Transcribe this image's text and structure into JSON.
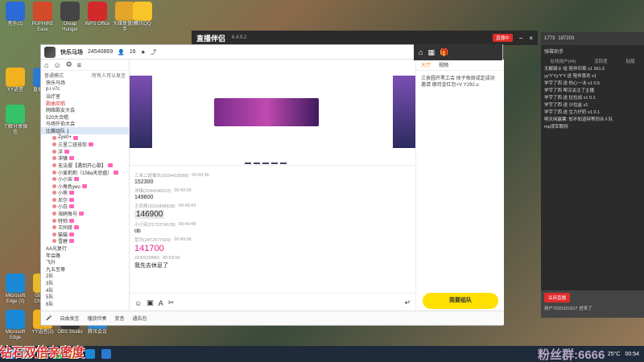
{
  "desktop_icons": [
    {
      "label": "音乐(1)",
      "color": "#2c6bd6"
    },
    {
      "label": "PUPHIRE Ease",
      "color": "#d24a2a"
    },
    {
      "label": "Dreap Hunger",
      "color": "#444444"
    },
    {
      "label": "WPS Office",
      "color": "#d22a2a"
    },
    {
      "label": "大雄复盘助手",
      "color": "#e4a62a"
    },
    {
      "label": "腾讯QQ",
      "color": "#f7c52a"
    },
    {
      "label": "YY语音",
      "color": "#f2b21e"
    },
    {
      "label": "直播伴侣",
      "color": "#2a7ad2"
    },
    {
      "label": "了解分享微信",
      "color": "#36c26a"
    },
    {
      "label": "Microsoft Edge (2)",
      "color": "#1a8ad6"
    },
    {
      "label": "Google Chrome",
      "color": "#e8b82a"
    },
    {
      "label": "Microsoft Edge",
      "color": "#1a8ad6"
    },
    {
      "label": "YY语音(2)",
      "color": "#f2b21e"
    },
    {
      "label": "OBS Studio",
      "color": "#333333"
    },
    {
      "label": "腾讯会议",
      "color": "#2a8ad6"
    }
  ],
  "topwin": {
    "brand": "直播伴侣",
    "version": "6.4.9.2",
    "rec_label": "直播中"
  },
  "app": {
    "title": "快乐马场",
    "room_id": "24540869",
    "online": "16",
    "left_tabs": [
      "普通模式"
    ],
    "left_header": "所有人可以发言",
    "tree": [
      {
        "label": "快乐马场",
        "style": ""
      },
      {
        "label": "p.i v7c",
        "style": ""
      },
      {
        "label": "治疗室",
        "style": ""
      },
      {
        "label": "歌曲欢唱",
        "style": "red"
      },
      {
        "label": "网络歌友大会",
        "style": ""
      },
      {
        "label": "520大合唱",
        "style": ""
      },
      {
        "label": "马场仟伯大会",
        "style": ""
      },
      {
        "label": "比赛组队 1",
        "style": "hl"
      },
      {
        "label": "Zye0+",
        "style": "sub"
      },
      {
        "label": "三里二班孩你",
        "style": "sub"
      },
      {
        "label": "洋",
        "style": "sub"
      },
      {
        "label": "冲锋",
        "style": "sub"
      },
      {
        "label": "无法摆【遇到开心歌】",
        "style": "sub"
      },
      {
        "label": "小爱莉莉（156a天恐盘）",
        "style": "sub"
      },
      {
        "label": "小小宋",
        "style": "sub"
      },
      {
        "label": "小角色yeo",
        "style": "sub"
      },
      {
        "label": "小熊",
        "style": "sub"
      },
      {
        "label": "尼尔",
        "style": "sub"
      },
      {
        "label": "小白",
        "style": "sub"
      },
      {
        "label": "海鸥每号",
        "style": "sub"
      },
      {
        "label": "特帅",
        "style": "sub"
      },
      {
        "label": "王同择",
        "style": "sub"
      },
      {
        "label": "猫猫",
        "style": "sub"
      },
      {
        "label": "雪碧",
        "style": "sub"
      },
      {
        "label": "AA光复行",
        "style": ""
      },
      {
        "label": "年会路",
        "style": ""
      },
      {
        "label": "飞升",
        "style": ""
      },
      {
        "label": "九五至尊",
        "style": ""
      },
      {
        "label": "2队",
        "style": ""
      },
      {
        "label": "3队",
        "style": ""
      },
      {
        "label": "4队",
        "style": ""
      },
      {
        "label": "5队",
        "style": ""
      },
      {
        "label": "6队",
        "style": ""
      }
    ],
    "messages": [
      {
        "who": "三米二班猫头(3104418588)",
        "time": "00:49:36",
        "text": "152300",
        "style": ""
      },
      {
        "who": "冲锋(2044246632)",
        "time": "00:49:39",
        "text": "149800",
        "style": ""
      },
      {
        "who": "王同择(2023458838)",
        "time": "00:49:43",
        "text": "146900",
        "style": "big box"
      },
      {
        "who": "小小宋(2172274678)",
        "time": "00:49:48",
        "text": "ob",
        "style": ""
      },
      {
        "who": "尼尔(2472677926)",
        "time": "00:49:56",
        "text": "141700",
        "style": "pink"
      },
      {
        "who": "#23(523880)",
        "time": "00:53:09",
        "text": "我先去休息了",
        "style": ""
      }
    ],
    "right_tabs": [
      "大厅",
      "视频"
    ],
    "right_notice": "三食圆开黑工会 体子每周成定成功邀请 德司金红包+V Y292.u",
    "join_label": "我要组队",
    "bottom_bar": [
      "自由发言",
      "播放伴奏",
      "变音",
      "通告包"
    ]
  },
  "live_window": {
    "title": "弹幕助手",
    "stats": [
      "1773",
      "187203"
    ],
    "tabs": [
      "在线用户(44)",
      "活跃度",
      "贴靓"
    ],
    "lines": [
      "无解骑士 给 陪伴印章 x1 361.6",
      "yy'Y'Yy'Y'Y 送 陪伴喜欢 x1",
      "学宇了西 送 你心一冰 x1 0.5",
      "学宇了西 帮汉关注了主播",
      "学宇了西 送 拉拉战 x1 0.1",
      "学宇了西 送 沙拉盒 x1",
      "学宇了西 送 生力仔奶 x1 0.1",
      "明天网赢薯: 知不知道特等同许人队",
      "mp误军联网"
    ],
    "bottom_label": "关闭直播",
    "bottom_user": "用户7025331917 进来了"
  },
  "overlay_text": "钻石双倍亲密度",
  "overlay_text2": "粉丝群:6666",
  "taskbar": {
    "weather": "25°C",
    "time": "00:54"
  }
}
